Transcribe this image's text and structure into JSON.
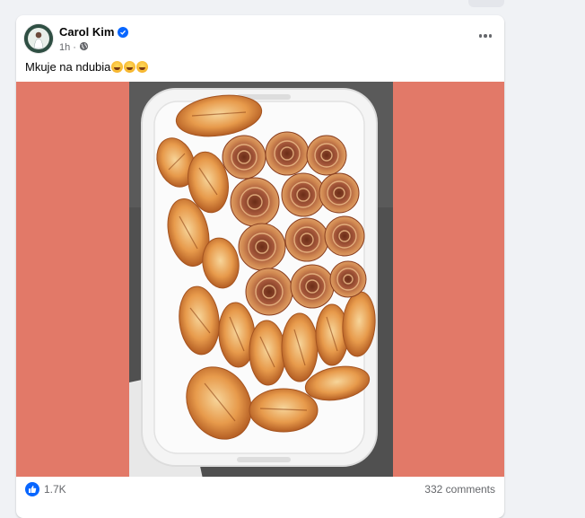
{
  "post": {
    "author": "Carol Kim",
    "time": "1h",
    "caption": "Mkuje na ndubia",
    "caption_emojis": [
      "grinning-sweat-emoji",
      "grinning-sweat-emoji",
      "grinning-sweat-emoji"
    ],
    "likes": "1.7K",
    "comments": "332 comments"
  },
  "colors": {
    "media_background": "#e27968",
    "accent": "#0866ff"
  }
}
